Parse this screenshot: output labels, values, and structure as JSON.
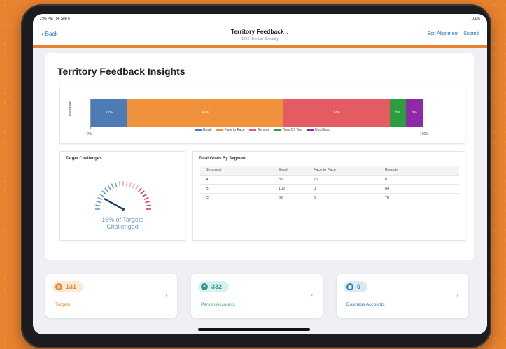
{
  "status": {
    "time": "2:45 PM  Tue Sep 6",
    "battery": "100%"
  },
  "nav": {
    "back_label": "Back",
    "title": "Territory Feedback",
    "subtitle": "1222: Trenton Specialty",
    "edit_label": "Edit Alignment",
    "submit_label": "Submit"
  },
  "insights": {
    "title": "Territory Feedback Insights"
  },
  "chart_data": {
    "type": "bar",
    "orientation": "horizontal-stacked",
    "ylabel": "Utilization",
    "xlim": [
      0,
      100
    ],
    "tick_labels": [
      "0%",
      "100%"
    ],
    "legend_position": "bottom",
    "series": [
      {
        "name": "Email",
        "values": [
          11
        ],
        "label": "11%",
        "color": "#4c7bb5"
      },
      {
        "name": "Face to Face",
        "values": [
          47
        ],
        "label": "47%",
        "color": "#f0913c"
      },
      {
        "name": "Remote",
        "values": [
          32
        ],
        "label": "32%",
        "color": "#e45b63"
      },
      {
        "name": "Time Off Terr",
        "values": [
          5
        ],
        "label": "5%",
        "color": "#2d9e3f"
      },
      {
        "name": "Unutilized",
        "values": [
          5
        ],
        "label": "5%",
        "color": "#8e2aa5"
      }
    ]
  },
  "challenges": {
    "title": "Target Challenges",
    "percent": 16,
    "line1": "16% of Targets",
    "line2": "Challenged"
  },
  "goals": {
    "title": "Total Goals By Segment",
    "columns": [
      "Segment ↑",
      "Email",
      "Face to Face",
      "Remote"
    ],
    "rows": [
      [
        "A",
        "35",
        "75",
        "0"
      ],
      [
        "B",
        "102",
        "0",
        "84"
      ],
      [
        "C",
        "62",
        "0",
        "78"
      ]
    ]
  },
  "stats": [
    {
      "value": "131",
      "label": "Targets",
      "color": "#e8822e",
      "bg": "#fde9d8",
      "icon": "target-icon"
    },
    {
      "value": "332",
      "label": "Person Accounts",
      "color": "#2a9d8f",
      "bg": "#d9f1ee",
      "icon": "person-icon"
    },
    {
      "value": "0",
      "label": "Business Accounts",
      "color": "#2a7fa8",
      "bg": "#dcebf3",
      "icon": "building-icon"
    }
  ]
}
